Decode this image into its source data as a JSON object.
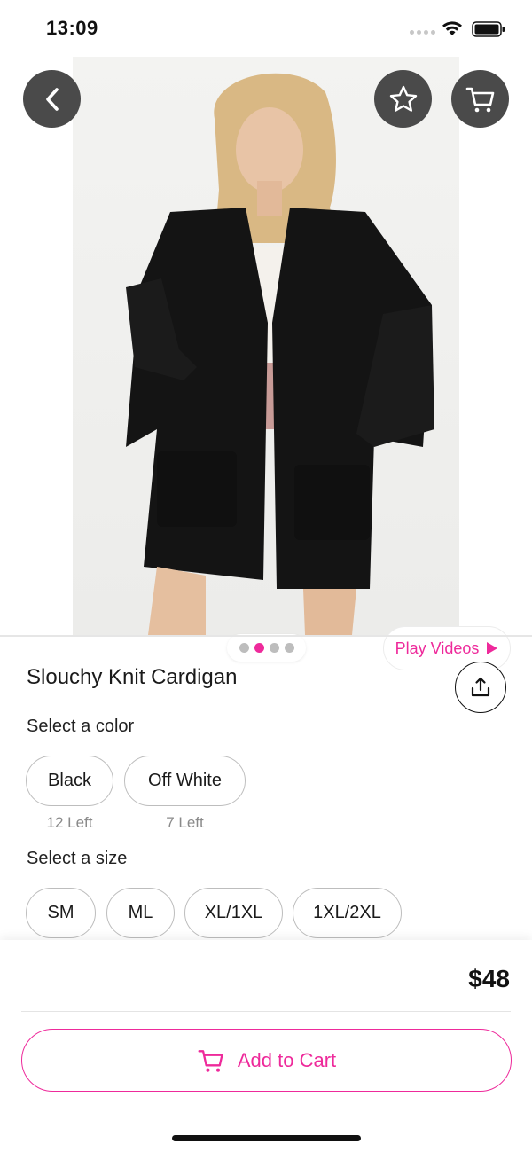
{
  "status_bar": {
    "time": "13:09",
    "icons": [
      "signal-dots-icon",
      "wifi-icon",
      "battery-icon"
    ]
  },
  "hero": {
    "image_description_icon": "product-photo",
    "pager": {
      "count": 4,
      "active_index": 1
    },
    "play_videos_label": "Play Videos",
    "buttons": [
      "back-icon",
      "star-icon",
      "cart-icon"
    ]
  },
  "product": {
    "title": "Slouchy Knit Cardigan",
    "color_label": "Select a color",
    "colors": [
      {
        "name": "Black",
        "stock": "12 Left"
      },
      {
        "name": "Off White",
        "stock": "7 Left"
      }
    ],
    "size_label": "Select a size",
    "sizes": [
      "SM",
      "ML",
      "XL/1XL",
      "1XL/2XL"
    ]
  },
  "checkout": {
    "price": "$48",
    "add_to_cart_label": "Add to Cart"
  },
  "colors": {
    "accent": "#ee2a9b",
    "overlay_button": "#4a4a4a"
  }
}
